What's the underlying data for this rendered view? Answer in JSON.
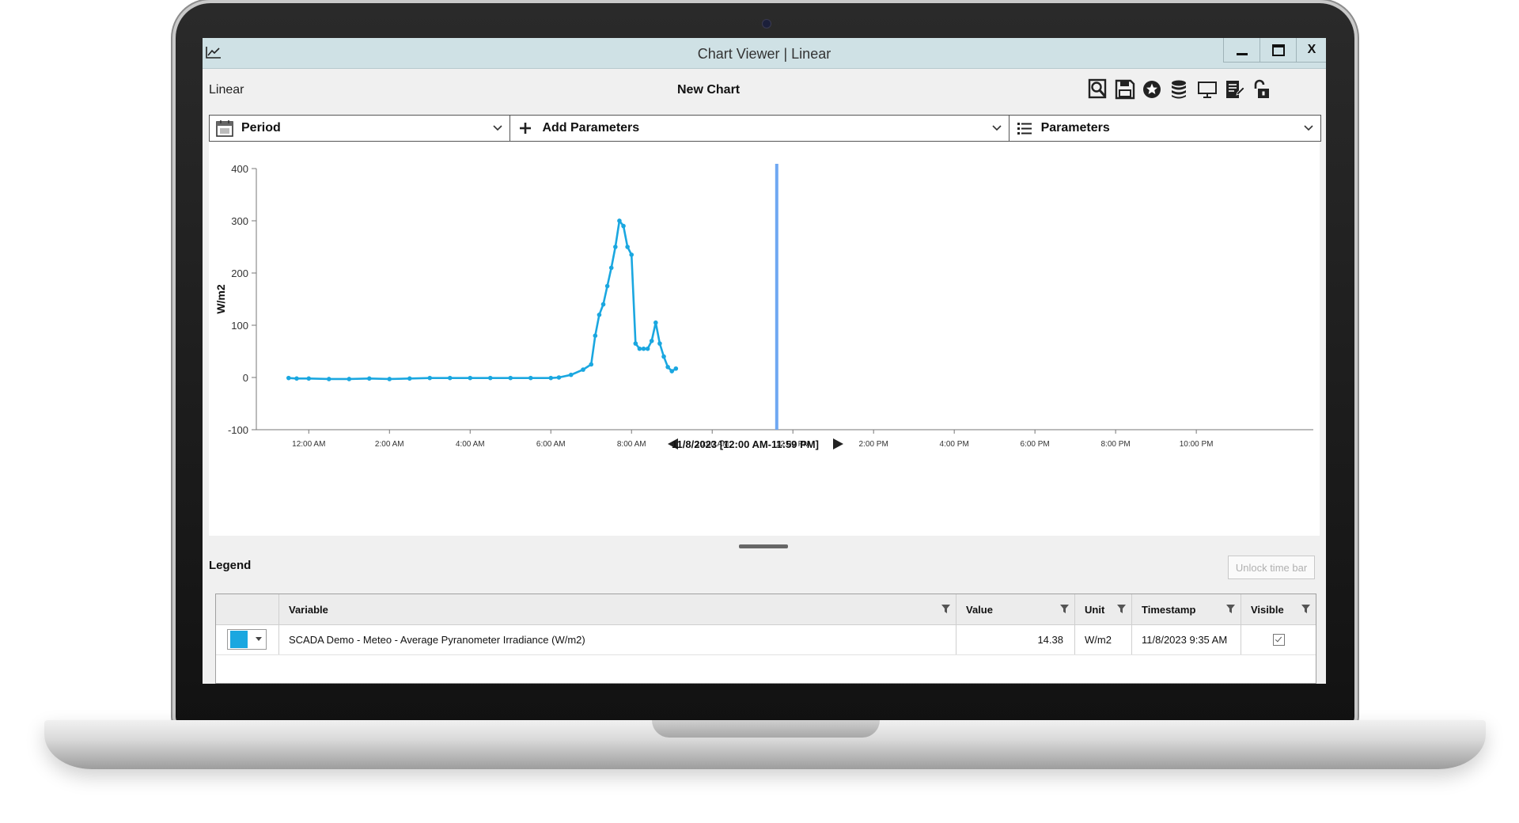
{
  "window": {
    "title": "Chart Viewer | Linear"
  },
  "window_buttons": {
    "minimize": "",
    "maximize": "",
    "close": "X"
  },
  "toolbar": {
    "view_label": "Linear",
    "chart_name": "New Chart",
    "icons": [
      "zoom-icon",
      "save-icon",
      "favorite-star-icon",
      "database-icon",
      "monitor-icon",
      "report-icon",
      "unlock-icon"
    ]
  },
  "selectors": {
    "period_label": "Period",
    "add_parameters_label": "Add Parameters",
    "parameters_label": "Parameters"
  },
  "period_nav": {
    "label": "11/8/2023 [12:00 AM-11:59 PM]"
  },
  "legend": {
    "title": "Legend",
    "unlock_button": "Unlock time bar",
    "columns": [
      "Variable",
      "Value",
      "Unit",
      "Timestamp",
      "Visible"
    ],
    "rows": [
      {
        "color": "#1aa7e0",
        "variable": "SCADA Demo - Meteo - Average Pyranometer Irradiance (W/m2)",
        "value": "14.38",
        "unit": "W/m2",
        "timestamp": "11/8/2023 9:35 AM",
        "visible": true
      }
    ]
  },
  "colors": {
    "series": "#1aa7e0",
    "time_cursor": "#6fa8f2",
    "titlebar": "#cfe1e5"
  },
  "chart_data": {
    "type": "line",
    "ylabel": "W/m2",
    "xlabel": "",
    "ylim": [
      -100,
      400
    ],
    "xlim_hours": [
      -1.3,
      24.9
    ],
    "y_ticks": [
      400,
      300,
      200,
      100,
      0,
      -100
    ],
    "x_ticks": [
      {
        "hour": 0,
        "label": "12:00 AM"
      },
      {
        "hour": 2,
        "label": "2:00 AM"
      },
      {
        "hour": 4,
        "label": "4:00 AM"
      },
      {
        "hour": 6,
        "label": "6:00 AM"
      },
      {
        "hour": 8,
        "label": "8:00 AM"
      },
      {
        "hour": 10,
        "label": "10:00 AM"
      },
      {
        "hour": 12,
        "label": "12:00 PM"
      },
      {
        "hour": 14,
        "label": "2:00 PM"
      },
      {
        "hour": 16,
        "label": "4:00 PM"
      },
      {
        "hour": 18,
        "label": "6:00 PM"
      },
      {
        "hour": 20,
        "label": "8:00 PM"
      },
      {
        "hour": 22,
        "label": "10:00 PM"
      }
    ],
    "time_cursor_hour": 11.6,
    "grid": false,
    "series": [
      {
        "values_x_hours": [
          -0.5,
          -0.3,
          0,
          0.5,
          1,
          1.5,
          2,
          2.5,
          3,
          3.5,
          4,
          4.5,
          5,
          5.5,
          6,
          6.2,
          6.5,
          6.8,
          7,
          7.1,
          7.2,
          7.3,
          7.4,
          7.5,
          7.6,
          7.7,
          7.8,
          7.9,
          8.0,
          8.1,
          8.2,
          8.3,
          8.4,
          8.5,
          8.6,
          8.7,
          8.8,
          8.9,
          9.0,
          9.1
        ],
        "values_y": [
          -1,
          -2,
          -2,
          -3,
          -3,
          -2,
          -3,
          -2,
          -1,
          -1,
          -1,
          -1,
          -1,
          -1,
          -1,
          0,
          5,
          15,
          25,
          80,
          120,
          140,
          175,
          210,
          250,
          300,
          290,
          250,
          235,
          65,
          55,
          55,
          55,
          70,
          105,
          65,
          40,
          20,
          12,
          17
        ]
      }
    ]
  }
}
